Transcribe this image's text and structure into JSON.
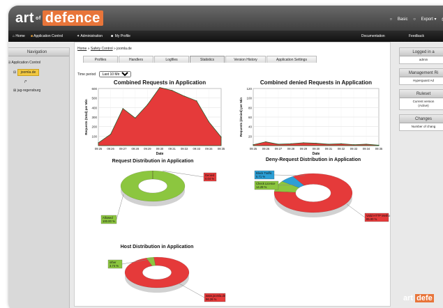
{
  "brand": {
    "logo_main": "art",
    "logo_of": "of",
    "logo_accent": "defence",
    "accent": "#e8753a"
  },
  "topbar": {
    "basic": "Basic",
    "export": "Export"
  },
  "menu": {
    "home": "Home",
    "app_control": "Application Control",
    "admin": "Administration",
    "profile": "My Profile",
    "docs": "Documentation",
    "feedback": "Feedback"
  },
  "nav": {
    "title": "Navigation",
    "items": [
      "Application Control",
      "joomla.de",
      "/*",
      "jug-regensburg"
    ]
  },
  "breadcrumb": {
    "home": "Home",
    "sep": "»",
    "safety": "Safety Control",
    "current": "joomla.de"
  },
  "tabs": [
    "Profiles",
    "Handlers",
    "Logfiles",
    "Statistics",
    "Version History",
    "Application Settings"
  ],
  "time_period": {
    "label": "Time period",
    "value": "Last 10 Min"
  },
  "right": {
    "logged_head": "Logged in a",
    "logged_val": "admin",
    "mgmt_head": "Management Ri",
    "mgmt_val": "Hyperguard Ad",
    "ruleset_head": "Ruleset",
    "ruleset_val1": "Current version",
    "ruleset_val2": "(Active)",
    "changes_head": "Changes",
    "changes_val": "Number of chang"
  },
  "footer_logo": {
    "main": "art",
    "accent": "defe"
  },
  "chart_data": [
    {
      "type": "area",
      "title": "Combined Requests in Application",
      "xlabel": "Date",
      "ylabel": "Requests (total) per Min",
      "x": [
        "09:25",
        "09:26",
        "09:27",
        "09:28",
        "09:29",
        "09:30",
        "09:31",
        "09:32",
        "09:33",
        "09:34",
        "09:35"
      ],
      "values": [
        30,
        120,
        390,
        290,
        430,
        610,
        580,
        520,
        470,
        250,
        90
      ],
      "ylim": [
        0,
        600
      ],
      "yticks": [
        100,
        200,
        300,
        400,
        500,
        600
      ],
      "color": "#e53a3a",
      "grid": true
    },
    {
      "type": "area",
      "title": "Combined denied Requests in Application",
      "xlabel": "Date",
      "ylabel": "Requests (denied) per Min",
      "x": [
        "09:25",
        "09:26",
        "09:27",
        "09:28",
        "09:29",
        "09:30",
        "09:31",
        "09:32",
        "09:33",
        "09:34",
        "09:35"
      ],
      "values": [
        2,
        8,
        3,
        4,
        6,
        5,
        3,
        4,
        2,
        3,
        1
      ],
      "ylim": [
        0,
        120
      ],
      "yticks": [
        20,
        40,
        60,
        80,
        100,
        120
      ],
      "color": "#e53a3a",
      "grid": true
    },
    {
      "type": "pie",
      "title": "Request Distribution in Application",
      "slices": [
        {
          "label": "Allowed",
          "pct": "100.00 %",
          "value": 99.96,
          "color": "#8cc63f"
        },
        {
          "label": "Denied",
          "pct": "0.04 %",
          "value": 0.04,
          "color": "#e53a3a"
        }
      ]
    },
    {
      "type": "pie",
      "title": "Deny-Request Distribution in Application",
      "slices": [
        {
          "label": "Valid HTTP Method",
          "pct": "85.00 %",
          "value": 85,
          "color": "#e53a3a"
        },
        {
          "label": "Check Licence",
          "pct": "14.29 %",
          "value": 9,
          "color": "#8cc63f"
        },
        {
          "label": "Block Traffic",
          "pct": "5.71 %",
          "value": 6,
          "color": "#2c9fd6"
        }
      ]
    },
    {
      "type": "pie",
      "title": "Host Distribution in Application",
      "slices": [
        {
          "label": "www.joomla.de",
          "pct": "96.26 %",
          "value": 96.26,
          "color": "#e53a3a"
        },
        {
          "label": "other",
          "pct": "3.74 %",
          "value": 3.74,
          "color": "#8cc63f"
        }
      ]
    }
  ]
}
